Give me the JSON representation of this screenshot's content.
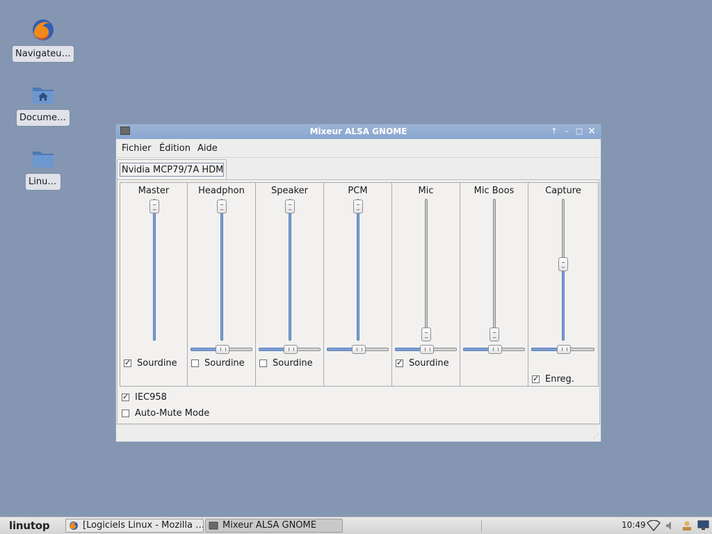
{
  "desktop": {
    "icons": [
      {
        "label": "Navigateur…",
        "icon": "firefox-icon"
      },
      {
        "label": "Documents",
        "icon": "home-folder-icon"
      },
      {
        "label": "Linutop",
        "icon": "folder-icon"
      }
    ]
  },
  "window": {
    "title": "Mixeur ALSA GNOME",
    "menu": [
      "Fichier",
      "Édition",
      "Aide"
    ],
    "tab": "Nvidia MCP79/7A HDMI",
    "channels": [
      {
        "name": "Master",
        "volume": 1.0,
        "balance": null,
        "mute_label": "Sourdine",
        "mute": true
      },
      {
        "name": "Headphon",
        "volume": 1.0,
        "balance": 0.5,
        "mute_label": "Sourdine",
        "mute": false
      },
      {
        "name": "Speaker",
        "volume": 1.0,
        "balance": 0.5,
        "mute_label": "Sourdine",
        "mute": false
      },
      {
        "name": "PCM",
        "volume": 1.0,
        "balance": 0.5,
        "mute_label": null,
        "mute": null
      },
      {
        "name": "Mic",
        "volume": 0.0,
        "balance": 0.5,
        "mute_label": "Sourdine",
        "mute": true
      },
      {
        "name": "Mic Boos",
        "volume": 0.0,
        "balance": 0.5,
        "mute_label": null,
        "mute": null
      },
      {
        "name": "Capture",
        "volume": 0.55,
        "balance": 0.5,
        "record_label": "Enreg.",
        "record": true
      }
    ],
    "switches": [
      {
        "label": "IEC958",
        "checked": true
      },
      {
        "label": "Auto-Mute Mode",
        "checked": false
      }
    ]
  },
  "taskbar": {
    "logo": "linutop",
    "tasks": [
      {
        "label": "[Logiciels Linux - Mozilla …",
        "icon": "firefox-icon"
      },
      {
        "label": "Mixeur ALSA GNOME",
        "icon": "mixer-icon",
        "active": true
      }
    ],
    "clock": "10:49"
  },
  "colors": {
    "desktop": "#8496b1",
    "accent": "#7e9ed4",
    "titlebar": "#8aa6cf"
  }
}
